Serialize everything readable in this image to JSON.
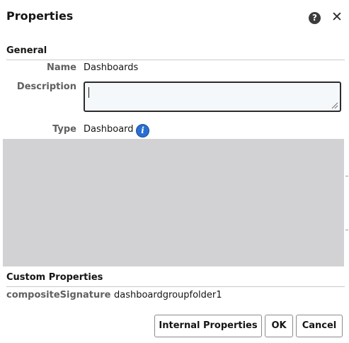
{
  "dialog": {
    "title": "Properties",
    "help_icon": "question-mark-circle-icon",
    "close_icon": "close-x-icon"
  },
  "general": {
    "section_title": "General",
    "name_label": "Name",
    "name_value": "Dashboards",
    "description_label": "Description",
    "description_value": "",
    "type_label": "Type",
    "type_value": "Dashboard",
    "type_info_icon": "info-icon"
  },
  "custom": {
    "section_title": "Custom Properties",
    "properties": [
      {
        "key": "compositeSignature",
        "value": "dashboardgroupfolder1"
      }
    ]
  },
  "buttons": {
    "internal_properties": "Internal Properties",
    "ok": "OK",
    "cancel": "Cancel"
  },
  "colors": {
    "accent_blue": "#2a6fcf",
    "panel_grey": "#d2d2d4",
    "label_grey": "#606060"
  }
}
